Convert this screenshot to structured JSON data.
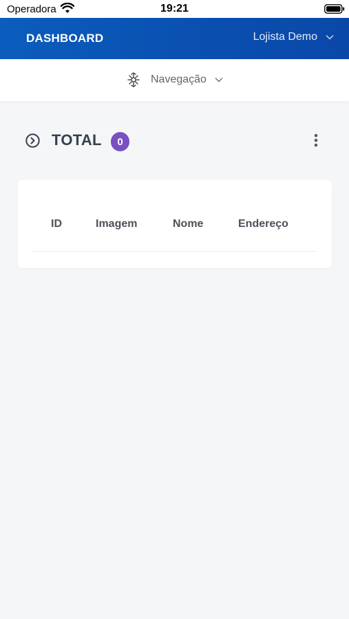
{
  "status_bar": {
    "carrier": "Operadora",
    "time": "19:21"
  },
  "header": {
    "title": "DASHBOARD",
    "user": "Lojista Demo"
  },
  "navigation": {
    "label": "Navegação",
    "icon": "compass-icon"
  },
  "summary": {
    "title": "TOTAL",
    "count": "0",
    "badge_color": "#7a4fc2"
  },
  "table": {
    "columns": [
      "ID",
      "Imagem",
      "Nome",
      "Endereço"
    ],
    "rows": []
  },
  "colors": {
    "header_bg": "#0b5dbd",
    "page_bg": "#f5f6f8"
  }
}
